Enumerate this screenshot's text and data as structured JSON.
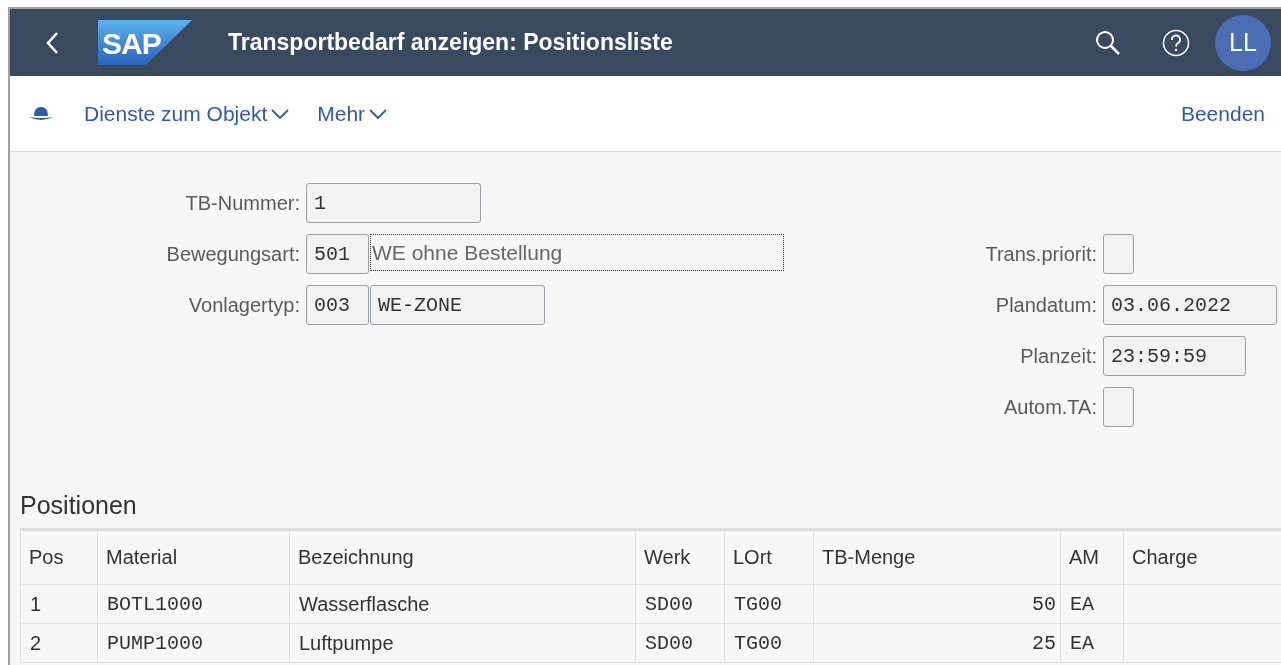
{
  "header": {
    "title": "Transportbedarf anzeigen: Positionsliste",
    "logo": "SAP",
    "avatar": "LL"
  },
  "toolbar": {
    "menus": [
      "Dienste zum Objekt",
      "Mehr"
    ],
    "exit": "Beenden"
  },
  "form": {
    "left": [
      {
        "label": "TB-Nummer:",
        "fields": [
          {
            "kind": "input",
            "value": "1"
          }
        ]
      },
      {
        "label": "Bewegungsart:",
        "fields": [
          {
            "kind": "code",
            "value": "501"
          },
          {
            "kind": "description",
            "value": "WE ohne Bestellung"
          }
        ]
      },
      {
        "label": "Vonlagertyp:",
        "fields": [
          {
            "kind": "code",
            "value": "003"
          },
          {
            "kind": "input",
            "value": "WE-ZONE"
          }
        ]
      }
    ],
    "right": [
      {
        "label": "Trans.priorit:",
        "kind": "flag"
      },
      {
        "label": "Plandatum:",
        "kind": "date",
        "value": "03.06.2022"
      },
      {
        "label": "Planzeit:",
        "kind": "time",
        "value": "23:59:59"
      },
      {
        "label": "Autom.TA:",
        "kind": "checkbox",
        "checked": false
      }
    ]
  },
  "positions": {
    "title": "Positionen",
    "columns": [
      {
        "label": "Pos",
        "kind": "text"
      },
      {
        "label": "Material",
        "kind": "code"
      },
      {
        "label": "Bezeichnung",
        "kind": "text"
      },
      {
        "label": "Werk",
        "kind": "code"
      },
      {
        "label": "LOrt",
        "kind": "code"
      },
      {
        "label": "TB-Menge",
        "kind": "number"
      },
      {
        "label": "AM",
        "kind": "code"
      },
      {
        "label": "Charge",
        "kind": "code"
      }
    ],
    "rows": [
      [
        "1",
        "BOTL1000",
        "Wasserflasche",
        "SD00",
        "TG00",
        "50",
        "EA",
        null
      ],
      [
        "2",
        "PUMP1000",
        "Luftpumpe",
        "SD00",
        "TG00",
        "25",
        "EA",
        null
      ]
    ]
  }
}
